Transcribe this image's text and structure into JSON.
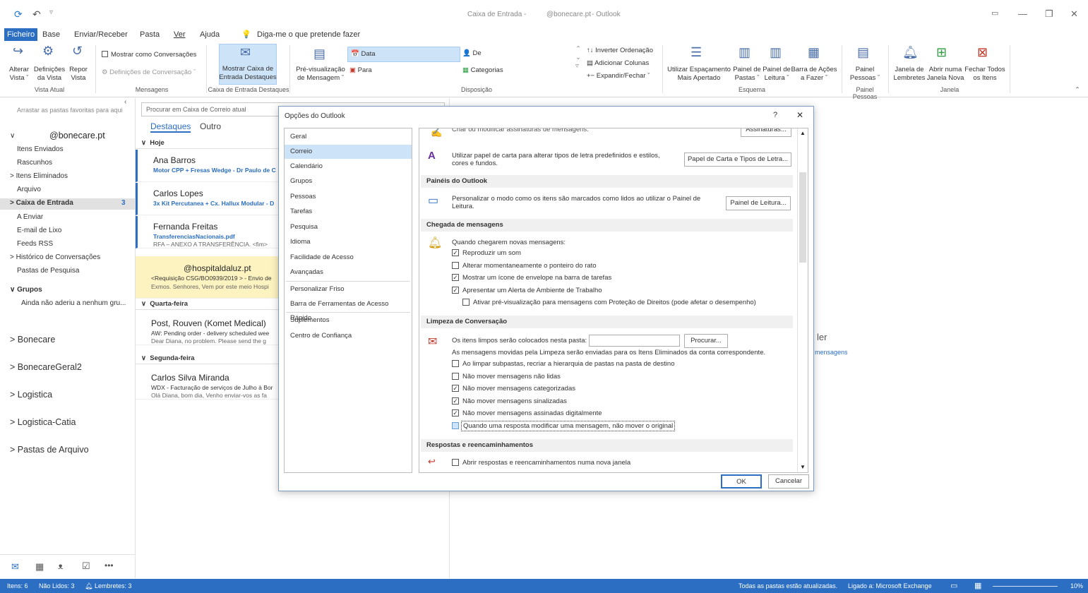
{
  "titlebar": {
    "inbox": "Caixa de Entrada -",
    "account": "@bonecare.pt",
    "app": "- Outlook"
  },
  "menu": [
    "Ficheiro",
    "Base",
    "Enviar/Receber",
    "Pasta",
    "Ver",
    "Ajuda"
  ],
  "tell_me": "Diga-me o que pretende fazer",
  "ribbon": {
    "alterar_vista": [
      "Alterar",
      "Vista ˇ"
    ],
    "definicoes_vista": [
      "Definições",
      "da Vista"
    ],
    "repor_vista": [
      "Repor",
      "Vista"
    ],
    "group_vista_atual": "Vista Atual",
    "mostrar_conversacoes": "Mostrar como Conversações",
    "definicoes_conversacao": "Definições de Conversação ˇ",
    "group_mensagens": "Mensagens",
    "mostrar_caixa": [
      "Mostrar Caixa de",
      "Entrada Destaques"
    ],
    "group_caixa_destaques": "Caixa de Entrada Destaques",
    "pre_visualizacao": [
      "Pré-visualização",
      "de Mensagem ˇ"
    ],
    "data": "Data",
    "de": "De",
    "para": "Para",
    "categorias": "Categorias",
    "inverter": "Inverter Ordenação",
    "adicionar_colunas": "Adicionar Colunas",
    "expandir": "Expandir/Fechar ˇ",
    "group_disposicao": "Disposição",
    "espacamento": [
      "Utilizar Espaçamento",
      "Mais Apertado"
    ],
    "painel_pastas": [
      "Painel de",
      "Pastas ˇ"
    ],
    "painel_leitura": [
      "Painel de",
      "Leitura ˇ"
    ],
    "barra_fazer": [
      "Barra de Ações",
      "a Fazer ˇ"
    ],
    "group_esquema": "Esquema",
    "painel_pessoas": [
      "Painel",
      "Pessoas ˇ"
    ],
    "group_painel_pessoas": "Painel Pessoas",
    "janela_lembretes": [
      "Janela de",
      "Lembretes"
    ],
    "abrir_janela": [
      "Abrir numa",
      "Janela Nova"
    ],
    "fechar_todos": [
      "Fechar Todos",
      "os Itens"
    ],
    "group_janela": "Janela"
  },
  "folders": {
    "favorites_hint": "Arrastar as pastas favoritas para aqui",
    "account": "@bonecare.pt",
    "items": [
      {
        "label": "Itens Enviados",
        "count": ""
      },
      {
        "label": "Rascunhos",
        "count": ""
      },
      {
        "label": "> Itens Eliminados",
        "count": ""
      },
      {
        "label": "Arquivo",
        "count": ""
      },
      {
        "label": "> Caixa de Entrada",
        "count": "3"
      },
      {
        "label": "A Enviar",
        "count": ""
      },
      {
        "label": "E-mail de Lixo",
        "count": ""
      },
      {
        "label": "Feeds RSS",
        "count": ""
      },
      {
        "label": "> Histórico de Conversações",
        "count": ""
      },
      {
        "label": "Pastas de Pesquisa",
        "count": ""
      }
    ],
    "grupos": "Grupos",
    "grupos_note": "Ainda não aderiu a nenhum gru...",
    "groups": [
      "> Bonecare",
      "> BonecareGeral2",
      "> Logistica",
      "> Logistica-Catia",
      "> Pastas de Arquivo"
    ]
  },
  "list": {
    "search_placeholder": "Procurar em Caixa de Correio atual",
    "tab_focused": "Destaques",
    "tab_other": "Outro",
    "today": "Hoje",
    "wednesday": "Quarta-feira",
    "monday": "Segunda-feira",
    "messages": [
      {
        "sender": "Ana Barros",
        "subject": "Motor CPP + Fresas Wedge - Dr Paulo de C",
        "preview": ""
      },
      {
        "sender": "Carlos Lopes",
        "subject": "3x Kit Percutanea + Cx. Hallux Modular - D",
        "preview": ""
      },
      {
        "sender": "Fernanda Freitas",
        "subject": "TransferenciasNacionais.pdf",
        "preview": "RFA – ANEXO A TRANSFERÊNCIA. <fim>"
      },
      {
        "sender": "@hospitaldaluz.pt",
        "subject": "<Requisição CSG/BO0939/2019 > - Envio de",
        "preview": "Exmos. Senhores,  Vem por este meio Hospi"
      },
      {
        "sender": "Post, Rouven (Komet Medical)",
        "subject": "AW: Pending order - delivery scheduled wee",
        "preview": "Dear Diana,  no problem. Please send the g"
      },
      {
        "sender": "Carlos Silva Miranda",
        "subject": "WDX - Facturação de serviços de Julho à Bor",
        "preview": "Olá Diana, bom dia,  Venho enviar-vos as fa"
      }
    ]
  },
  "reading": {
    "ler": "ler",
    "mensagens": "mensagens"
  },
  "dialog": {
    "title": "Opções do Outlook",
    "help": "?",
    "close": "✕",
    "nav": [
      "Geral",
      "Correio",
      "Calendário",
      "Grupos",
      "Pessoas",
      "Tarefas",
      "Pesquisa",
      "Idioma",
      "Facilidade de Acesso",
      "Avançadas",
      "Personalizar Friso",
      "Barra de Ferramentas de Acesso Rápido",
      "Suplementos",
      "Centro de Confiança"
    ],
    "top_cut": "Criar ou modificar assinaturas de mensagens.",
    "assinaturas_btn": "Assinaturas...",
    "papel_text": "Utilizar papel de carta para alterar tipos de letra predefinidos e estilos, cores e fundos.",
    "papel_btn": "Papel de Carta e Tipos de Letra...",
    "sec_paineis": "Painéis do Outlook",
    "paineis_text": "Personalizar o modo como os itens são marcados como lidos ao utilizar o Painel de Leitura.",
    "paineis_btn": "Painel de Leitura...",
    "sec_chegada": "Chegada de mensagens",
    "chegada_intro": "Quando chegarem novas mensagens:",
    "chegada_opts": [
      {
        "label": "Reproduzir um som",
        "checked": "✓"
      },
      {
        "label": "Alterar momentaneamente o ponteiro do rato",
        "checked": ""
      },
      {
        "label": "Mostrar um ícone de envelope na barra de tarefas",
        "checked": "✓"
      },
      {
        "label": "Apresentar um Alerta de Ambiente de Trabalho",
        "checked": "✓"
      },
      {
        "label": "Ativar pré-visualização para mensagens com Proteção de Direitos (pode afetar o desempenho)",
        "checked": ""
      }
    ],
    "sec_limpeza": "Limpeza de Conversação",
    "limpeza_folder": "Os itens limpos serão colocados nesta pasta:",
    "procurar_btn": "Procurar...",
    "limpeza_note": "As mensagens movidas pela Limpeza serão enviadas para os Itens Eliminados da conta correspondente.",
    "limpeza_opts": [
      {
        "label": "Ao limpar subpastas, recriar a hierarquia de pastas na pasta de destino",
        "checked": ""
      },
      {
        "label": "Não mover mensagens não lidas",
        "checked": ""
      },
      {
        "label": "Não mover mensagens categorizadas",
        "checked": "✓"
      },
      {
        "label": "Não mover mensagens sinalizadas",
        "checked": "✓"
      },
      {
        "label": "Não mover mensagens assinadas digitalmente",
        "checked": "✓"
      },
      {
        "label": "Quando uma resposta modificar uma mensagem, não mover o original",
        "checked": ""
      }
    ],
    "sec_respostas": "Respostas e reencaminhamentos",
    "respostas_opt": "Abrir respostas e reencaminhamentos numa nova janela",
    "ok": "OK",
    "cancel": "Cancelar"
  },
  "status": {
    "itens": "Itens: 6",
    "naolidos": "Não Lidos: 3",
    "lembretes": "Lembretes: 3",
    "atualizadas": "Todas as pastas estão atualizadas.",
    "ligado": "Ligado a: Microsoft Exchange",
    "zoom": "10%"
  },
  "colors": {
    "accent": "#2b6ec2",
    "selected": "#cde3f7",
    "highlight_row": "#fdf3c0"
  }
}
